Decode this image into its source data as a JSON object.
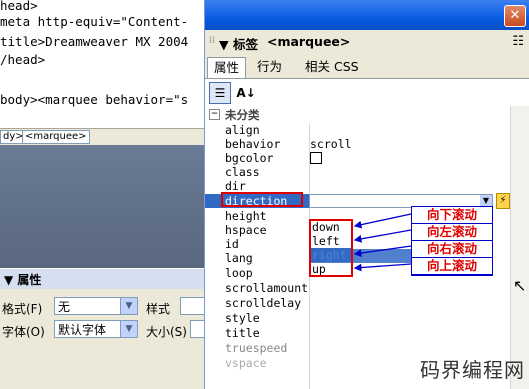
{
  "code_view": {
    "lines": [
      "head>",
      "meta http-equiv=\"Content-",
      "title>Dreamweaver MX 2004",
      "/head>",
      "",
      "body><marquee behavior=\"s"
    ]
  },
  "tag_selector": {
    "items": [
      "dy>",
      "<marquee>"
    ]
  },
  "properties_panel": {
    "header": "▼ 属性",
    "format_label": "格式(F)",
    "format_value": "无",
    "style_label": "样式",
    "font_label": "字体(O)",
    "font_value": "默认字体",
    "size_label": "大小(S)"
  },
  "tag_inspector": {
    "group_title": "▼ 标签",
    "tag": "<marquee>",
    "tabs": [
      "属性",
      "行为",
      "相关 CSS"
    ],
    "active_tab": "属性",
    "category": "未分类",
    "attributes": [
      {
        "name": "align",
        "value": ""
      },
      {
        "name": "behavior",
        "value": "scroll"
      },
      {
        "name": "bgcolor",
        "value": ""
      },
      {
        "name": "class",
        "value": ""
      },
      {
        "name": "dir",
        "value": ""
      },
      {
        "name": "direction",
        "value": ""
      },
      {
        "name": "height",
        "value": ""
      },
      {
        "name": "hspace",
        "value": ""
      },
      {
        "name": "id",
        "value": ""
      },
      {
        "name": "lang",
        "value": ""
      },
      {
        "name": "loop",
        "value": ""
      },
      {
        "name": "scrollamount",
        "value": ""
      },
      {
        "name": "scrolldelay",
        "value": ""
      },
      {
        "name": "style",
        "value": ""
      },
      {
        "name": "title",
        "value": ""
      },
      {
        "name": "truespeed",
        "value": ""
      },
      {
        "name": "vspace",
        "value": ""
      }
    ],
    "direction_options": [
      "down",
      "left",
      "right",
      "up"
    ],
    "selected_option": "right",
    "annotations": [
      "向下滚动",
      "向左滚动",
      "向右滚动",
      "向上滚动"
    ]
  },
  "colors": {
    "titlebar": "#0a5ce0",
    "highlight": "#316ac5",
    "annotation_text": "#e00000",
    "arrow": "#0000cc"
  },
  "watermark": "码界编程网"
}
